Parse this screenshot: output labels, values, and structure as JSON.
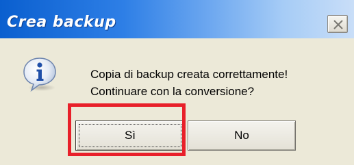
{
  "dialog": {
    "title": "Crea backup",
    "close_icon": "close-icon",
    "icon": "info-icon",
    "message_line1": "Copia di backup creata correttamente!",
    "message_line2": "Continuare con la conversione?",
    "buttons": {
      "yes_label": "Sì",
      "no_label": "No"
    },
    "annotation": {
      "type": "highlight-box",
      "target": "yes-button",
      "color": "#e8202a"
    }
  },
  "colors": {
    "titlebar_start": "#0a5fcf",
    "titlebar_end": "#c9def8",
    "dialog_background": "#ece9d8"
  }
}
